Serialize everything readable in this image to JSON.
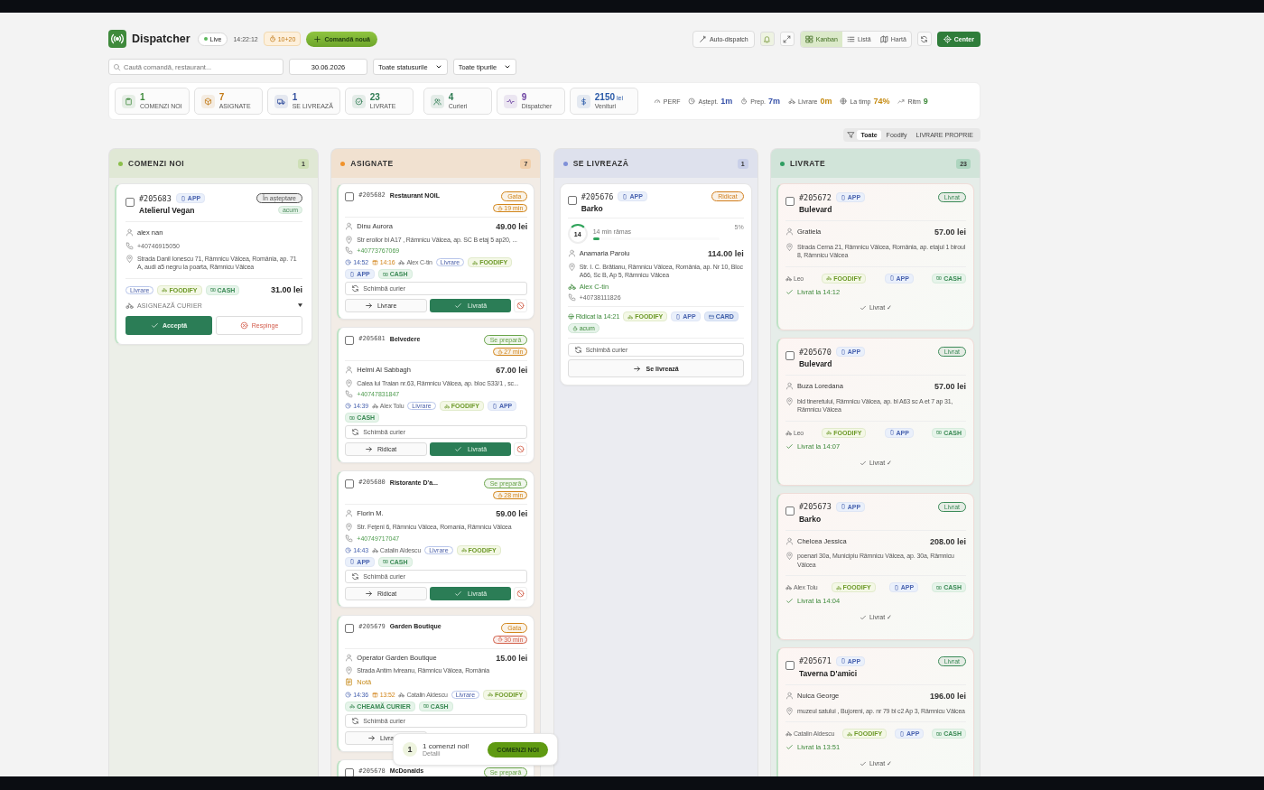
{
  "header": {
    "title": "Dispatcher",
    "live": "Live",
    "clock": "14:22:12",
    "timer_badge": "10+20",
    "new_order": "Comandă nouă",
    "auto_dispatch": "Auto-dispatch",
    "views": [
      {
        "label": "Kanban",
        "selected": true
      },
      {
        "label": "Listă",
        "selected": false
      },
      {
        "label": "Hartă",
        "selected": false
      }
    ],
    "center": "Center"
  },
  "filters": {
    "search_placeholder": "Caută comandă, restaurant...",
    "date": "30.06.2026",
    "status_select": "Toate statusurile",
    "type_select": "Toate tipurile"
  },
  "stats": [
    {
      "value": "1",
      "label": "COMENZI NOI",
      "color": "#3f8a3c"
    },
    {
      "value": "7",
      "label": "ASIGNATE",
      "color": "#c27a17"
    },
    {
      "value": "1",
      "label": "SE LIVREAZĂ",
      "color": "#33509e"
    },
    {
      "value": "23",
      "label": "LIVRATE",
      "color": "#2e7a52"
    },
    {
      "value": "4",
      "label": "Curieri",
      "color": "#2e7a52"
    },
    {
      "value": "9",
      "label": "Dispatcher",
      "color": "#6a3fa0"
    },
    {
      "value": "2150",
      "unit": "lei",
      "label": "Venituri",
      "color": "#2a5aa8"
    }
  ],
  "perf": {
    "label": "PERF",
    "metrics": [
      {
        "label": "Aștept.",
        "value": "1m",
        "color": "#3550a8"
      },
      {
        "label": "Prep.",
        "value": "7m",
        "color": "#3550a8"
      },
      {
        "label": "Livrare",
        "value": "0m",
        "color": "#c58a10"
      },
      {
        "label": "La timp",
        "value": "74%",
        "color": "#c58a10"
      },
      {
        "label": "Ritm",
        "value": "9",
        "color": "#3f8a3c"
      }
    ]
  },
  "source_filter": [
    {
      "label": "Toate",
      "selected": true
    },
    {
      "label": "Foodify",
      "selected": false
    },
    {
      "label": "LIVRARE PROPRIE",
      "selected": false
    }
  ],
  "columns": [
    {
      "title": "COMENZI NOI",
      "count": "1",
      "color": "#8bbf4a",
      "cards": [
        {
          "kind": "new",
          "checked": false,
          "id": "#205683",
          "source": "APP",
          "restaurant": "Atelierul Vegan",
          "status": {
            "label": "În așteptare",
            "color": "#555555"
          },
          "age": "acum",
          "customer": "alex nan",
          "phone": "+40746915050",
          "address": "Strada Danil Ionescu 71, Râmnicu Vâlcea, România, ap. 71 A, audi a5 negru la poarta, Râmnicu Vâlcea",
          "tags": [
            {
              "kind": "type",
              "label": "Livrare"
            },
            {
              "kind": "foodify",
              "label": "FOODIFY"
            },
            {
              "kind": "cash",
              "label": "CASH"
            }
          ],
          "total": "31.00 lei",
          "assign": "ASIGNEAZĂ CURIER",
          "accept": "Acceptă",
          "reject": "Respinge"
        }
      ]
    },
    {
      "title": "ASIGNATE",
      "count": "7",
      "color": "#f0922b",
      "cards": [
        {
          "kind": "assigned",
          "checked": false,
          "id": "#205682",
          "restaurant": "Restaurant NOIL",
          "status": {
            "label": "Gata",
            "color": "#d2861c"
          },
          "timer": {
            "label": "19 min",
            "color": "#d2861c"
          },
          "customer": "Dinu Aurora",
          "total": "49.00 lei",
          "address": "Str eroilor bl A17 , Râmnicu Vâlcea, ap. SC B etaj 5 ap20, ...",
          "phone": "+40773767069",
          "placed": "14:52",
          "ready": "14:16",
          "courier": "Alex C-tin",
          "tags": [
            {
              "kind": "type",
              "label": "Livrare"
            },
            {
              "kind": "foodify",
              "label": "FOODIFY"
            },
            {
              "kind": "app",
              "label": "APP"
            },
            {
              "kind": "cash",
              "label": "CASH"
            }
          ],
          "change_courier": "Schimbă curier",
          "action": "Livrare",
          "done": "Livrată"
        },
        {
          "kind": "assigned",
          "checked": false,
          "id": "#205681",
          "restaurant": "Belvedere",
          "status": {
            "label": "Se prepară",
            "color": "#6aa44a"
          },
          "timer": {
            "label": "27 min",
            "color": "#d2861c"
          },
          "customer": "Helmi Al Sabbagh",
          "total": "67.00 lei",
          "address": "Calea lui Traian nr.63, Râmnicu Vâlcea, ap. bloc S33/1 , sc...",
          "phone": "+40747831847",
          "placed": "14:39",
          "courier": "Alex Tolu",
          "tags": [
            {
              "kind": "type",
              "label": "Livrare"
            },
            {
              "kind": "foodify",
              "label": "FOODIFY"
            },
            {
              "kind": "app",
              "label": "APP"
            },
            {
              "kind": "cash",
              "label": "CASH"
            }
          ],
          "change_courier": "Schimbă curier",
          "action": "Ridicat",
          "done": "Livrată"
        },
        {
          "kind": "assigned",
          "checked": false,
          "id": "#205680",
          "restaurant": "Ristorante D'a...",
          "status": {
            "label": "Se prepară",
            "color": "#6aa44a"
          },
          "timer": {
            "label": "28 min",
            "color": "#d2861c"
          },
          "customer": "Florin M.",
          "total": "59.00 lei",
          "address": "Str. Feţeni 6, Râmnicu Vâlcea, Romania, Râmnicu Vâlcea",
          "phone": "+40749717047",
          "placed": "14:43",
          "courier": "Catalin Aldescu",
          "tags": [
            {
              "kind": "type",
              "label": "Livrare"
            },
            {
              "kind": "foodify",
              "label": "FOODIFY"
            },
            {
              "kind": "app",
              "label": "APP"
            },
            {
              "kind": "cash",
              "label": "CASH"
            }
          ],
          "change_courier": "Schimbă curier",
          "action": "Ridicat",
          "done": "Livrată"
        },
        {
          "kind": "assigned",
          "checked": false,
          "id": "#205679",
          "restaurant": "Garden Boutique",
          "status": {
            "label": "Gata",
            "color": "#d2861c"
          },
          "timer": {
            "label": "30 min",
            "color": "#d2604a"
          },
          "customer": "Operator Garden Boutique",
          "total": "15.00 lei",
          "address": "Strada Antim Ivireanu, Râmnicu Vâlcea, România",
          "note": "Notă",
          "placed": "14:36",
          "ready": "13:52",
          "courier": "Catalin Aldescu",
          "tags": [
            {
              "kind": "type",
              "label": "Livrare"
            },
            {
              "kind": "foodify",
              "label": "FOODIFY"
            },
            {
              "kind": "call",
              "label": "CHEAMĂ CURIER"
            },
            {
              "kind": "cash",
              "label": "CASH"
            }
          ],
          "change_courier": "Schimbă curier",
          "action": "Livra"
        },
        {
          "kind": "assigned",
          "checked": false,
          "id": "#205678",
          "restaurant": "McDonalds",
          "status": {
            "label": "Se prepară",
            "color": "#6aa44a"
          }
        }
      ]
    },
    {
      "title": "SE LIVREAZĂ",
      "count": "1",
      "color": "#7f90d8",
      "cards": [
        {
          "kind": "delivering",
          "checked": false,
          "id": "#205676",
          "source": "APP",
          "restaurant": "Barko",
          "status": {
            "label": "Ridicat",
            "color": "#d17f1f"
          },
          "eta": "14",
          "remaining": "14 min rămas",
          "percent": "5%",
          "level": 0.05,
          "customer": "Anamaria Paroiu",
          "total": "114.00 lei",
          "address": "Str. I. C. Brătianu, Râmnicu Vâlcea, România, ap. Nr 10, Bloc A66, Sc B, Ap 5, Râmnicu Vâlcea",
          "courier": "Alex C-tin",
          "phone": "+40738111826",
          "picked_up": "Ridicat la 14:21",
          "tags": [
            {
              "kind": "foodify",
              "label": "FOODIFY"
            },
            {
              "kind": "app",
              "label": "APP"
            },
            {
              "kind": "card",
              "label": "CARD"
            }
          ],
          "age": "acum",
          "change_courier": "Schimbă curier",
          "action": "Se livrează"
        }
      ]
    },
    {
      "title": "LIVRATE",
      "count": "23",
      "color": "#2f9e62",
      "cards": [
        {
          "kind": "delivered",
          "checked": false,
          "id": "#205672",
          "source": "APP",
          "restaurant": "Bulevard",
          "status": {
            "label": "Livrat",
            "color": "#3c8b58"
          },
          "customer": "Gratiela",
          "total": "57.00 lei",
          "address": "Strada Cerna 21, Râmnicu Vâlcea, România, ap. etajul 1 biroul 8, Râmnicu Vâlcea",
          "courier": "Leo",
          "tags": [
            {
              "kind": "foodify",
              "label": "FOODIFY"
            },
            {
              "kind": "app",
              "label": "APP"
            },
            {
              "kind": "cash",
              "label": "CASH"
            }
          ],
          "delivered_at": "Livrat la 14:12",
          "footer": "Livrat ✓"
        },
        {
          "kind": "delivered",
          "checked": false,
          "id": "#205670",
          "source": "APP",
          "restaurant": "Bulevard",
          "status": {
            "label": "Livrat",
            "color": "#3c8b58"
          },
          "customer": "Buza Loredana",
          "total": "57.00 lei",
          "address": "bld tineretului, Râmnicu Vâlcea, ap. bl A63 sc A et 7 ap 31, Râmnicu Vâlcea",
          "courier": "Leo",
          "tags": [
            {
              "kind": "foodify",
              "label": "FOODIFY"
            },
            {
              "kind": "app",
              "label": "APP"
            },
            {
              "kind": "cash",
              "label": "CASH"
            }
          ],
          "delivered_at": "Livrat la 14:07",
          "footer": "Livrat ✓"
        },
        {
          "kind": "delivered",
          "checked": false,
          "id": "#205673",
          "source": "APP",
          "restaurant": "Barko",
          "status": {
            "label": "Livrat",
            "color": "#3c8b58"
          },
          "customer": "Chelcea Jessica",
          "total": "208.00 lei",
          "address": "poenari 30a, Municipiu Râmnicu Vâlcea, ap. 30a, Râmnicu Vâlcea",
          "courier": "Alex Tolu",
          "tags": [
            {
              "kind": "foodify",
              "label": "FOODIFY"
            },
            {
              "kind": "app",
              "label": "APP"
            },
            {
              "kind": "cash",
              "label": "CASH"
            }
          ],
          "delivered_at": "Livrat la 14:04",
          "footer": "Livrat ✓"
        },
        {
          "kind": "delivered",
          "checked": false,
          "id": "#205671",
          "source": "APP",
          "restaurant": "Taverna D'amici",
          "status": {
            "label": "Livrat",
            "color": "#3c8b58"
          },
          "customer": "Nuica George",
          "total": "196.00 lei",
          "address": "muzeul satului , Bujoreni, ap. nr 79 bl c2 Ap 3, Râmnicu Vâlcea",
          "courier": "Catalin Aldescu",
          "tags": [
            {
              "kind": "foodify",
              "label": "FOODIFY"
            },
            {
              "kind": "app",
              "label": "APP"
            },
            {
              "kind": "cash",
              "label": "CASH"
            }
          ],
          "delivered_at": "Livrat la 13:51",
          "footer": "Livrat ✓"
        }
      ]
    }
  ],
  "toast": {
    "count": "1",
    "message": "1 comenzi noi!",
    "details": "Detalii",
    "button": "COMENZI NOI"
  }
}
